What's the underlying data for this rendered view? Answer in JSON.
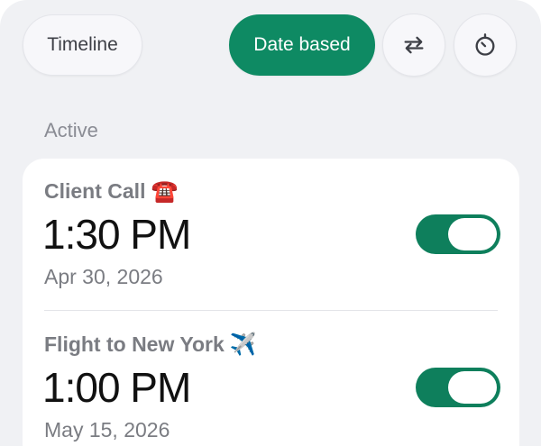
{
  "tabs": {
    "timeline_label": "Timeline",
    "date_based_label": "Date based",
    "active_tab": "Date based",
    "accent_color": "#0e8a63"
  },
  "icons": {
    "repeat": "repeat-icon",
    "timer": "timer-icon"
  },
  "section": {
    "title": "Active"
  },
  "alarms": [
    {
      "title": "Client Call",
      "emoji": "☎️",
      "time": "1:30 PM",
      "date": "Apr 30, 2026",
      "enabled": true
    },
    {
      "title": "Flight to New York",
      "emoji": "✈️",
      "time": "1:00 PM",
      "date": "May 15, 2026",
      "enabled": true
    }
  ]
}
